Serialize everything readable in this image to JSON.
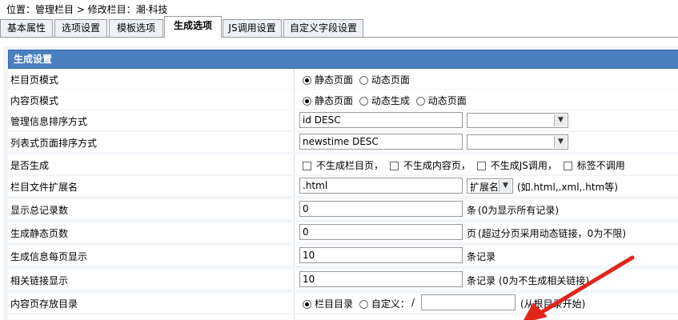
{
  "breadcrumb": "位置：管理栏目 > 修改栏目：潮·科技",
  "tabs": [
    {
      "label": "基本属性"
    },
    {
      "label": "选项设置"
    },
    {
      "label": "模板选项"
    },
    {
      "label": "生成选项",
      "active": true
    },
    {
      "label": "JS调用设置"
    },
    {
      "label": "自定义字段设置"
    }
  ],
  "section_title": "生成设置",
  "rows": {
    "list_page_mode": {
      "label": "栏目页模式",
      "options": [
        "静态页面",
        "动态页面"
      ],
      "selected": "静态页面"
    },
    "content_page_mode": {
      "label": "内容页模式",
      "options": [
        "静态页面",
        "动态生成",
        "动态页面"
      ],
      "selected": "静态页面"
    },
    "admin_sort": {
      "label": "管理信息排序方式",
      "value": "id DESC"
    },
    "list_sort": {
      "label": "列表式页面排序方式",
      "value": "newstime DESC"
    },
    "generate": {
      "label": "是否生成",
      "options": [
        "不生成栏目页，",
        "不生成内容页，",
        "不生成JS调用，",
        "标签不调用"
      ]
    },
    "ext": {
      "label": "栏目文件扩展名",
      "value": ".html",
      "select": "扩展名",
      "hint": "(如.html,.xml,.htm等)"
    },
    "total": {
      "label": "显示总记录数",
      "value": "0",
      "unit": "条",
      "hint": "(0为显示所有记录)"
    },
    "static_pages": {
      "label": "生成静态页数",
      "value": "0",
      "unit": "页",
      "hint": "(超过分页采用动态链接，0为不限)"
    },
    "per_page": {
      "label": "生成信息每页显示",
      "value": "10",
      "unit": "条记录"
    },
    "related": {
      "label": "相关链接显示",
      "value": "10",
      "unit": "条记录",
      "hint": "(0为不生成相关链接)"
    },
    "storage": {
      "label": "内容页存放目录",
      "options": [
        "栏目目录",
        "自定义："
      ],
      "selected": "栏目目录",
      "slash": "/",
      "hint": "(从根目录开始)"
    }
  },
  "colors": {
    "header": "#4a7fc0",
    "arrow": "#e0261b"
  }
}
